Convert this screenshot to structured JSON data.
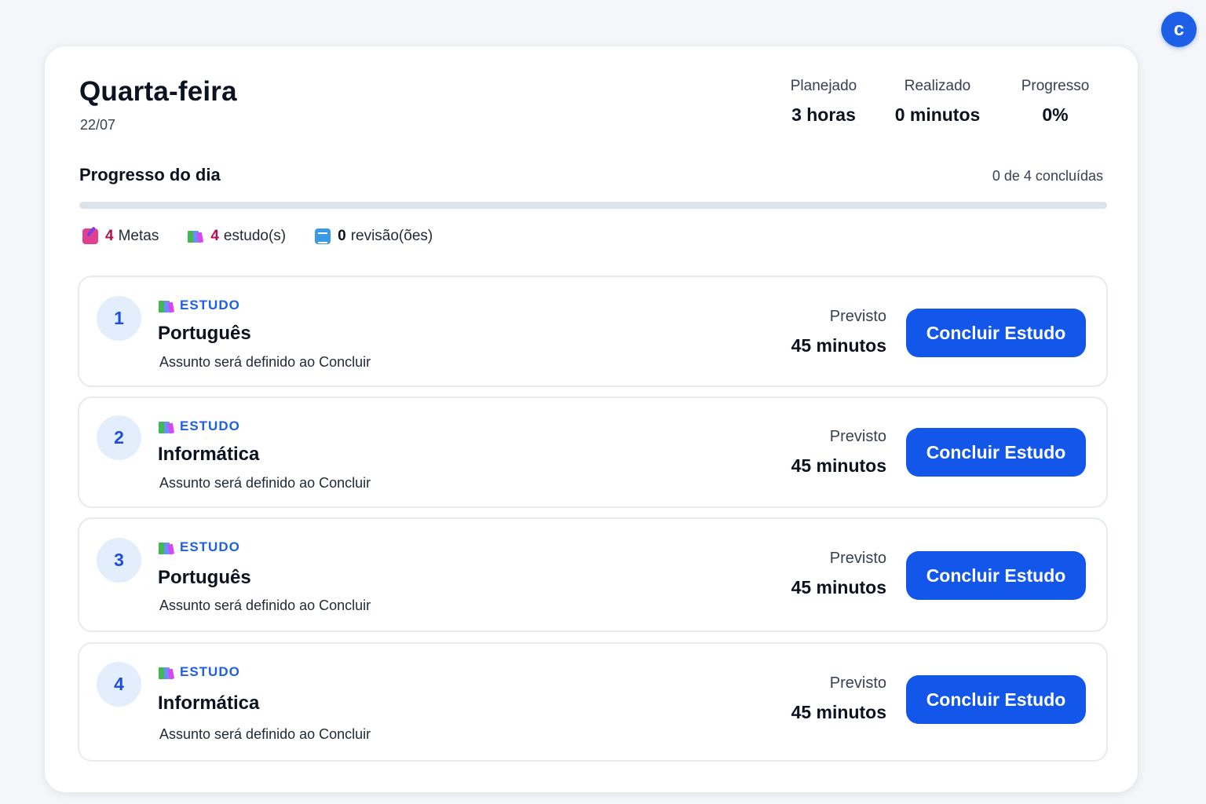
{
  "user": {
    "avatar_initial": "c"
  },
  "day": {
    "title": "Quarta-feira",
    "date": "22/07"
  },
  "stats": [
    {
      "label": "Planejado",
      "value": "3 horas"
    },
    {
      "label": "Realizado",
      "value": "0 minutos"
    },
    {
      "label": "Progresso",
      "value": "0%"
    }
  ],
  "progress": {
    "title": "Progresso do dia",
    "count_text": "0 de 4 concluídas",
    "completed_fraction": 0
  },
  "counters": {
    "metas": {
      "count": "4",
      "label": "Metas"
    },
    "estudos": {
      "count": "4",
      "label": "estudo(s)"
    },
    "revisoes": {
      "count": "0",
      "label": "revisão(ões)"
    }
  },
  "tasks": [
    {
      "number": "1",
      "kind": "ESTUDO",
      "subject": "Português",
      "note": "Assunto será definido ao Concluir",
      "planned_label": "Previsto",
      "planned_value": "45 minutos",
      "button": "Concluir Estudo"
    },
    {
      "number": "2",
      "kind": "ESTUDO",
      "subject": "Informática",
      "note": "Assunto será definido ao Concluir",
      "planned_label": "Previsto",
      "planned_value": "45 minutos",
      "button": "Concluir Estudo"
    },
    {
      "number": "3",
      "kind": "ESTUDO",
      "subject": "Português",
      "note": "Assunto será definido ao Concluir",
      "planned_label": "Previsto",
      "planned_value": "45 minutos",
      "button": "Concluir Estudo"
    },
    {
      "number": "4",
      "kind": "ESTUDO",
      "subject": "Informática",
      "note": "Assunto será definido ao Concluir",
      "planned_label": "Previsto",
      "planned_value": "45 minutos",
      "button": "Concluir Estudo"
    }
  ],
  "colors": {
    "accent": "#1257ea",
    "badge_bg": "#e3eefc",
    "count_red": "#b3124a"
  },
  "icons": {
    "metas": "memo-pencil-icon",
    "estudos": "books-icon",
    "revisoes": "card-index-icon",
    "task_kind": "books-icon"
  }
}
